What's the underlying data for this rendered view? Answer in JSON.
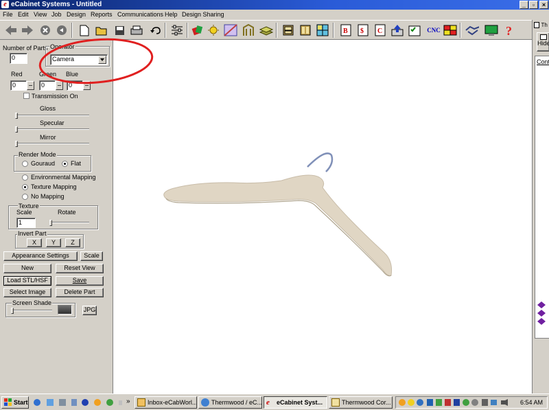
{
  "window": {
    "title": "eCabinet Systems - Untitled"
  },
  "menu": [
    "File",
    "Edit",
    "View",
    "Job",
    "Design",
    "Reports",
    "Communications",
    "Help",
    "Design Sharing"
  ],
  "toolbar": {
    "cnc_label": "CNC"
  },
  "panel": {
    "number_of_parts_label": "Number of Parts",
    "number_of_parts_value": "0",
    "operator_label": "Operator",
    "operator_value": "Camera",
    "red_label": "Red",
    "green_label": "Green",
    "blue_label": "Blue",
    "red_value": "0",
    "green_value": "0",
    "blue_value": "0",
    "transmission_label": "Transmission On",
    "gloss_label": "Gloss",
    "specular_label": "Specular",
    "mirror_label": "Mirror",
    "render_mode_label": "Render Mode",
    "gouraud_label": "Gouraud",
    "flat_label": "Flat",
    "env_mapping_label": "Environmental Mapping",
    "texture_mapping_label": "Texture Mapping",
    "no_mapping_label": "No Mapping",
    "texture_scale_label_1": "Texture",
    "texture_scale_label_2": "Scale",
    "texture_scale_value": "1",
    "rotate_label": "Rotate",
    "invert_part_label": "Invert Part",
    "x_label": "X",
    "y_label": "Y",
    "z_label": "Z",
    "appearance_settings_label": "Appearance Settings",
    "scale_label": "Scale",
    "new_label": "New",
    "reset_view_label": "Reset View",
    "load_label": "Load STL/HSF",
    "save_label": "Save",
    "select_image_label": "Select Image",
    "delete_part_label": "Delete Part",
    "screen_shade_label": "Screen Shade",
    "jpg_label": "JPG"
  },
  "right_panel": {
    "title_fragment": "Th",
    "hide_label": "Hide",
    "content_label": "Conte"
  },
  "taskbar": {
    "start_label": "Start",
    "tasks": [
      "Inbox-eCabWorl...",
      "Thermwood / eC...",
      "eCabinet Syst...",
      "Thermwood Cor..."
    ],
    "clock": "6:54 AM"
  },
  "colors": {
    "annotation": "#e02020",
    "hanger_body": "#e0d6c4",
    "hanger_hook": "#8090b8",
    "title_blue": "#0a246a"
  }
}
